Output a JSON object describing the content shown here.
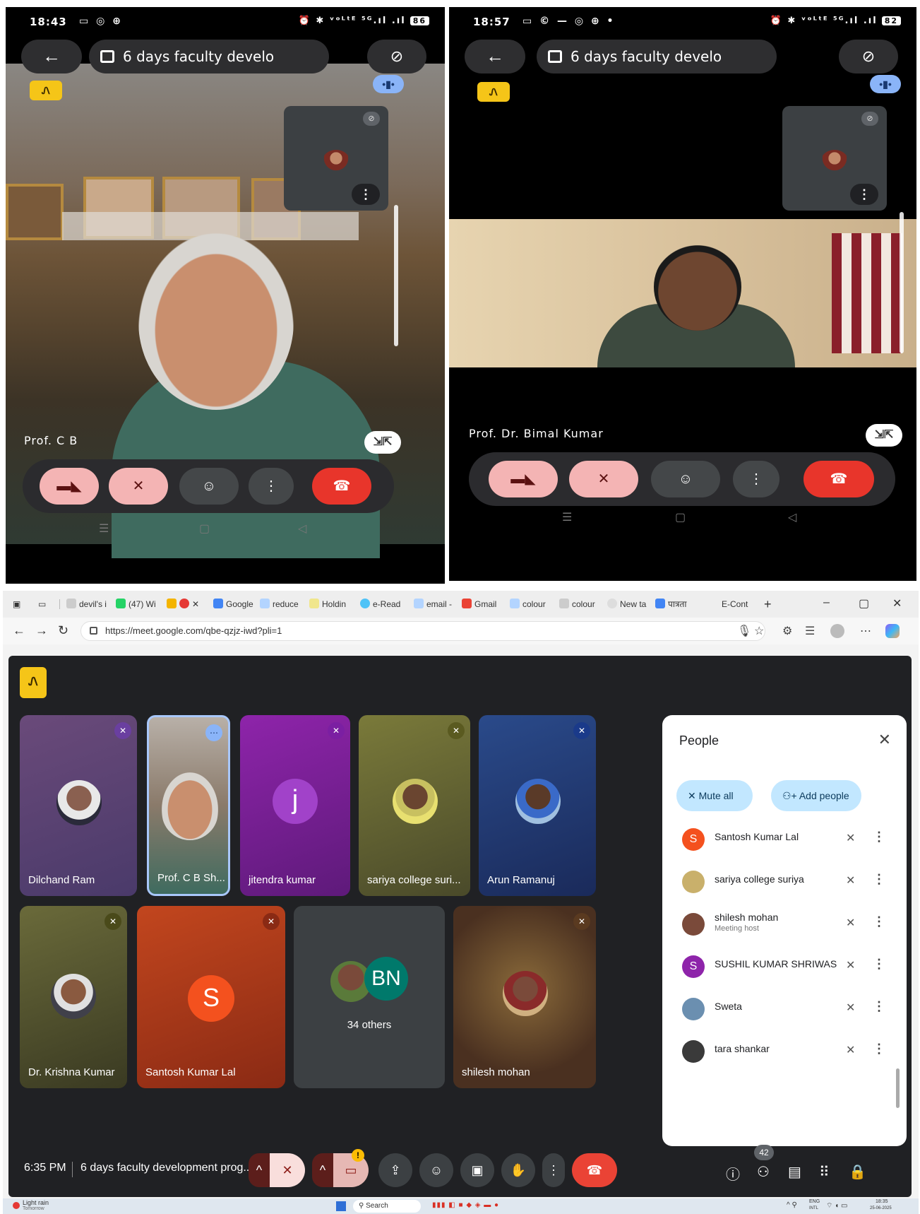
{
  "phone1": {
    "time": "18:43",
    "status_left": "▭ ◎ ⊕",
    "status_right": "⏰ ✱ ᵛᵒᴸᵗᴱ ⁵ᴳ.ıl .ıl",
    "battery": "86",
    "back_icon": "←",
    "meeting_title": "6 days faculty develo",
    "speaker_icon": "⊘",
    "badge": "Ꮑ",
    "speaker_name": "Prof. C B",
    "collapse_icon": "⇲⇱",
    "controls": [
      "▶",
      "🎤",
      "☺",
      "⋮",
      "☎"
    ]
  },
  "phone2": {
    "time": "18:57",
    "status_left": "▭ © — ◎ ⊕ •",
    "status_right": "⏰ ✱ ᵛᵒᴸᵗᴱ ⁵ᴳ.ıl .ıl",
    "battery": "82",
    "back_icon": "←",
    "meeting_title": "6 days faculty develo",
    "speaker_icon": "⊘",
    "badge": "Ꮑ",
    "speaker_name": "Prof. Dr. Bimal Kumar",
    "collapse_icon": "⇲⇱",
    "controls": [
      "▶",
      "🎤",
      "☺",
      "⋮",
      "☎"
    ]
  },
  "browser": {
    "tabs": [
      "devil's i",
      "(47) Wi",
      "",
      "Google",
      "reduce",
      "Holdin",
      "e-Read",
      "email -",
      "Gmail",
      "colour",
      "colour",
      "New ta",
      "पात्रता",
      "E-Cont"
    ],
    "new_tab": "+",
    "minimize": "–",
    "restore": "▢",
    "close": "✕",
    "url": "https://meet.google.com/qbe-qzjz-iwd?pli=1"
  },
  "meet": {
    "badge": "Ꮑ",
    "tiles": [
      {
        "name": "Dilchand Ram"
      },
      {
        "name": "Prof. C B Sh..."
      },
      {
        "name": "jitendra kumar",
        "letter": "j"
      },
      {
        "name": "sariya college suri..."
      },
      {
        "name": "Arun Ramanuj"
      },
      {
        "name": "Dr. Krishna Kumar"
      },
      {
        "name": "Santosh Kumar Lal",
        "letter": "S"
      },
      {
        "name": "34 others",
        "letter": "BN"
      },
      {
        "name": "shilesh mohan"
      }
    ],
    "people_panel": {
      "title": "People",
      "mute_all": "Mute all",
      "add_people": "Add people",
      "members": [
        {
          "name": "Santosh Kumar Lal",
          "letter": "S",
          "color": "#f4511e"
        },
        {
          "name": "sariya college suriya",
          "letter": "",
          "color": "#c9b06b"
        },
        {
          "name": "shilesh mohan",
          "sub": "Meeting host",
          "letter": "",
          "color": "#7a4a3a"
        },
        {
          "name": "SUSHIL KUMAR SHRIWAS",
          "letter": "S",
          "color": "#8e24aa"
        },
        {
          "name": "Sweta",
          "letter": "",
          "color": "#6b8fb0"
        },
        {
          "name": "tara shankar",
          "letter": "",
          "color": "#3a3a3a"
        }
      ]
    },
    "bottom": {
      "time": "6:35 PM",
      "title": "6 days faculty development prog...",
      "participant_count": "42"
    }
  },
  "taskbar": {
    "weather": "Light rain",
    "weather_sub": "Tomorrow",
    "search": "Search",
    "lang": "ENG",
    "lang_sub": "INTL",
    "clock": "18:35",
    "date": "25-06-2025"
  },
  "colors": {
    "meet_bg": "#202124",
    "hangup": "#ea4335",
    "accent_blue": "#c2e7ff",
    "badge_yellow": "#f5c518"
  }
}
